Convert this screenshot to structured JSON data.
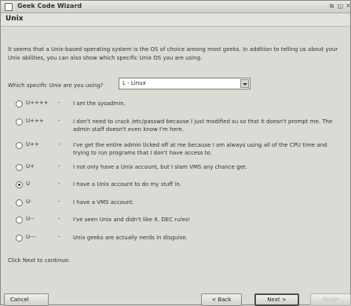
{
  "window": {
    "title": "Geek Code Wizard",
    "controls": {
      "maximize": "⧉",
      "restore": "◱",
      "close": "✕"
    }
  },
  "page": {
    "title": "Unix",
    "intro": "It seems that a Unix-based operating system is the OS of choice among most geeks. In addition to telling us about your Unix abilities, you can also show which specific Unix OS you are using.",
    "select_label": "Which specific Unix are you using?",
    "select_value": "L - Linux",
    "footer": "Click Next to continue."
  },
  "options": [
    {
      "code": "U++++",
      "dash": "-",
      "text": "I am the sysadmin.",
      "checked": false
    },
    {
      "code": "U+++",
      "dash": "-",
      "text": "I don't need to crack /etc/passwd because I just modified su so that it doesn't prompt me. The admin staff doesn't even know I'm here.",
      "checked": false
    },
    {
      "code": "U++",
      "dash": "-",
      "text": "I've get the entire admin ticked off at me because I am always using all of the CPU time and trying to run programs that I don't have access to.",
      "checked": false
    },
    {
      "code": "U+",
      "dash": "-",
      "text": "I not only have a Unix account, but I slam VMS any chance get.",
      "checked": false
    },
    {
      "code": "U",
      "dash": "-",
      "text": "I have a Unix account to do my stuff in.",
      "checked": true
    },
    {
      "code": "U-",
      "dash": "-",
      "text": "I have a VMS account.",
      "checked": false
    },
    {
      "code": "U--",
      "dash": "-",
      "text": "I've seen Unix and didn't like it. DEC rules!",
      "checked": false
    },
    {
      "code": "U---",
      "dash": "-",
      "text": "Unix geeks are actually nerds in disguise.",
      "checked": false
    }
  ],
  "buttons": {
    "cancel": "Cancel",
    "back": "< Back",
    "next": "Next >",
    "finish": "Finish"
  }
}
